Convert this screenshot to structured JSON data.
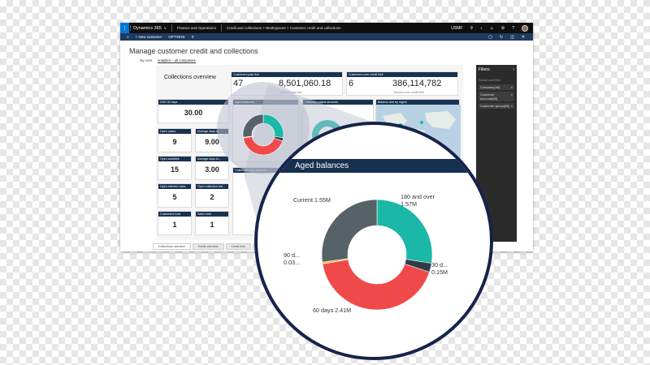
{
  "topbar": {
    "waffle": "⋮⋮⋮",
    "brand": "Dynamics 365",
    "brand_caret": "∨",
    "module": "Finance and Operations",
    "breadcrumb": "Credit and collections > Workspaces > Customer credit and collections",
    "user": "USMF",
    "icons": [
      "search-icon",
      "bell-icon",
      "smile-icon",
      "gear-icon",
      "help-icon"
    ]
  },
  "actionbar": {
    "menu": "≡",
    "new_customer": "+ New customer",
    "options": "OPTIONS",
    "search_glyph": "⚲"
  },
  "page": {
    "title": "Manage customer credit and collections",
    "tabs": [
      "My work",
      "Analytics – all companies"
    ]
  },
  "report": {
    "title": "Collections overview",
    "kpis": [
      {
        "header": "Customers past due",
        "value": "47",
        "big": "8,501,060.18",
        "sub": "Amount past due"
      },
      {
        "header": "Customers over credit limit",
        "value": "6",
        "big": "386,114,782",
        "sub": "Amount over credit limit"
      }
    ],
    "tiles": [
      {
        "header": "DSO 30 days",
        "value": "30.00"
      },
      {
        "header": "Open cases",
        "value": "9"
      },
      {
        "header": "Average days to...",
        "value": "9.00"
      },
      {
        "header": "Open activities",
        "value": "15"
      },
      {
        "header": "Average days to...",
        "value": "3.00"
      },
      {
        "header": "Open interest notes",
        "value": "5"
      },
      {
        "header": "Open collection lett...",
        "value": "2"
      },
      {
        "header": "Customers hold",
        "value": "1"
      },
      {
        "header": "Sales hold",
        "value": "1"
      }
    ],
    "panels": {
      "aged": "Aged balances",
      "collection_status": "Collection status amounts",
      "balance_region": "Balance due by region",
      "collection_code": "Collection code amounts"
    }
  },
  "filters": {
    "title": "Filters",
    "subtitle": "Select and filter",
    "items": [
      "Company(All)",
      "Customer account(All)",
      "Customer group(All)"
    ]
  },
  "doc_tabs": [
    "Collections overview",
    "Credit overview",
    "Credit limit",
    "Customer overview"
  ],
  "magnifier": {
    "title": "Aged balances",
    "labels": {
      "current": "Current 1.55M",
      "over180": "180 and over\n1.57M",
      "d30": "30 d...\n0.15M",
      "d90": "90 d...\n0.03...",
      "d60": "60 days 2.41M"
    }
  },
  "chart_data": {
    "type": "pie",
    "title": "Aged balances",
    "categories": [
      "180 and over",
      "30 days",
      "60 days",
      "90 days",
      "Current"
    ],
    "values": [
      1.57,
      0.15,
      2.41,
      0.03,
      1.55
    ],
    "units": "M",
    "colors": [
      "#1bb8a8",
      "#2f3d47",
      "#f0494a",
      "#f6c21c",
      "#566268"
    ]
  },
  "colors": {
    "topbar": "#0f0f0f",
    "actionbar": "#1f3a5f",
    "tile_header": "#17334f",
    "magnifier_ring": "#16234a"
  }
}
